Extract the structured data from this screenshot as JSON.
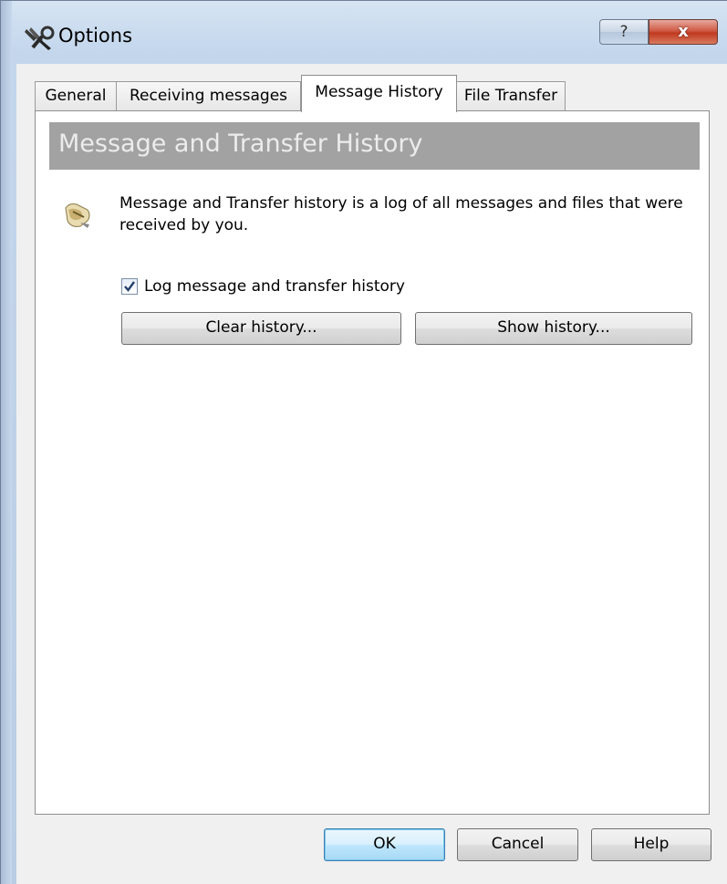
{
  "window": {
    "title": "Options",
    "help_button": "?",
    "close_button": "x"
  },
  "tabs": [
    {
      "label": "General",
      "active": false
    },
    {
      "label": "Receiving messages",
      "active": false
    },
    {
      "label": "Message History",
      "active": true
    },
    {
      "label": "File Transfer",
      "active": false
    }
  ],
  "panel": {
    "banner": "Message and Transfer History",
    "description": "Message and Transfer history is a log of all messages and files that were received by you.",
    "checkbox_label": "Log message and transfer history",
    "checkbox_checked": true,
    "clear_button": "Clear history...",
    "show_button": "Show history..."
  },
  "footer": {
    "ok": "OK",
    "cancel": "Cancel",
    "help": "Help"
  },
  "colors": {
    "banner_bg": "#a2a2a2",
    "banner_text": "#ececec",
    "default_button_border": "#3c7fb1"
  }
}
